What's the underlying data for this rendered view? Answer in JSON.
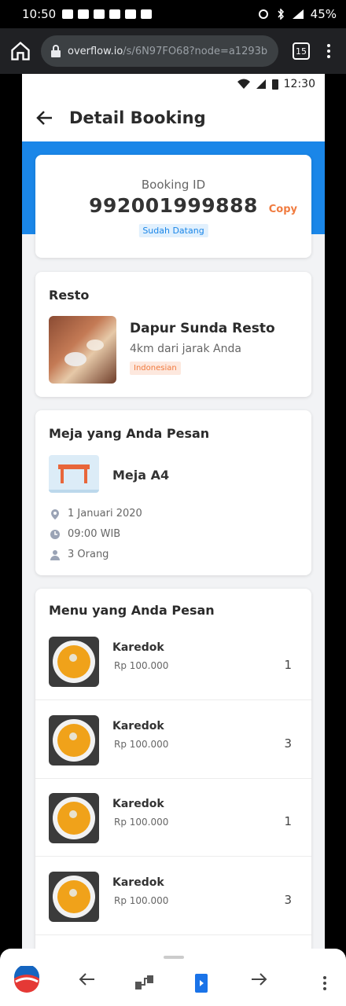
{
  "statusbar": {
    "time": "10:50",
    "battery": "45%"
  },
  "browser": {
    "domain": "overflow.io",
    "path": "/s/6N97FO68?node=a1293b",
    "tab_count": "15"
  },
  "inner_statusbar": {
    "time": "12:30"
  },
  "app": {
    "header_title": "Detail Booking",
    "booking": {
      "label": "Booking ID",
      "id": "992001999888",
      "copy_label": "Copy",
      "status": "Sudah Datang"
    },
    "resto": {
      "section_title": "Resto",
      "name": "Dapur Sunda Resto",
      "distance": "4km dari jarak Anda",
      "cuisine": "Indonesian"
    },
    "table": {
      "section_title": "Meja yang Anda Pesan",
      "name": "Meja A4",
      "date": "1 Januari 2020",
      "time": "09:00 WIB",
      "guests": "3 Orang"
    },
    "menu": {
      "section_title": "Menu yang Anda Pesan",
      "items": [
        {
          "name": "Karedok",
          "price": "Rp 100.000",
          "qty": "1"
        },
        {
          "name": "Karedok",
          "price": "Rp 100.000",
          "qty": "3"
        },
        {
          "name": "Karedok",
          "price": "Rp 100.000",
          "qty": "1"
        },
        {
          "name": "Karedok",
          "price": "Rp 100.000",
          "qty": "3"
        }
      ]
    }
  },
  "colors": {
    "primary_blue": "#1a86e8",
    "accent_orange": "#f07b3f",
    "status_badge_bg": "#e1f0fd"
  }
}
